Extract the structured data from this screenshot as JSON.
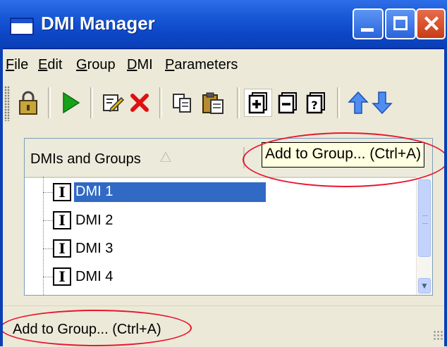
{
  "window": {
    "title": "DMI Manager",
    "controls": [
      "minimize",
      "maximize",
      "close"
    ],
    "close_glyph": "✕"
  },
  "menu": {
    "items": [
      {
        "label": "File",
        "accel": "F",
        "rest": "ile"
      },
      {
        "label": "Edit",
        "accel": "E",
        "rest": "dit"
      },
      {
        "label": "Group",
        "accel": "G",
        "rest": "roup"
      },
      {
        "label": "DMI",
        "accel": "D",
        "rest": "MI"
      },
      {
        "label": "Parameters",
        "accel": "P",
        "rest": "arameters"
      }
    ]
  },
  "toolbar": {
    "icons": [
      "lock-icon",
      "run-icon",
      "edit-icon",
      "delete-icon",
      "copy-icon",
      "paste-icon",
      "add-to-group-icon",
      "remove-from-group-icon",
      "group-properties-icon",
      "move-up-icon",
      "move-down-icon"
    ]
  },
  "list": {
    "column_header": "DMIs and Groups",
    "rows": [
      {
        "label": "DMI 1",
        "selected": true,
        "icon_glyph": "I"
      },
      {
        "label": "DMI 2",
        "selected": false,
        "icon_glyph": "I"
      },
      {
        "label": "DMI 3",
        "selected": false,
        "icon_glyph": "I"
      },
      {
        "label": "DMI 4",
        "selected": false,
        "icon_glyph": "I"
      }
    ]
  },
  "tooltip": {
    "text": "Add to Group... (Ctrl+A)"
  },
  "statusbar": {
    "text": "Add to Group... (Ctrl+A)"
  },
  "colors": {
    "titlebar": "#0c47c7",
    "selection": "#316ac5",
    "highlight_ellipse": "#e8162d",
    "tooltip_bg": "#ffffe1"
  }
}
